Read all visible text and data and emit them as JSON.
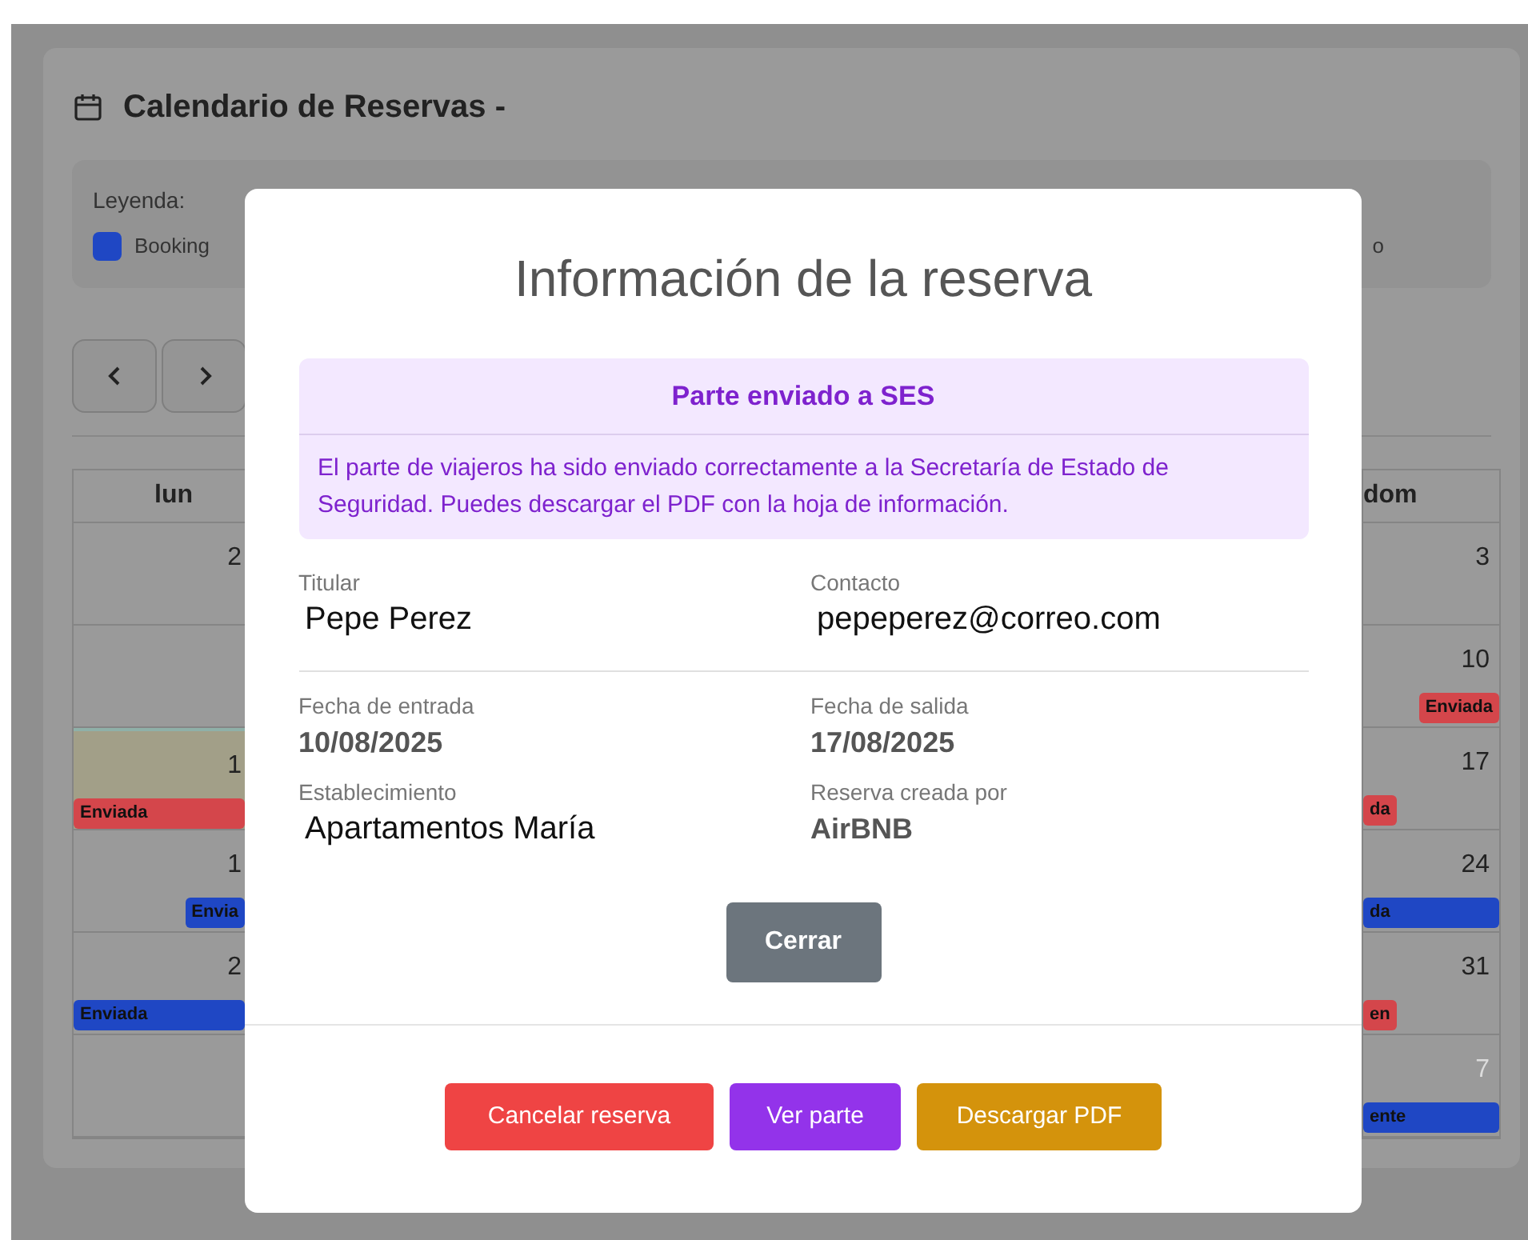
{
  "calendar_page": {
    "title": "Calendario de Reservas -",
    "legend": {
      "label": "Leyenda:",
      "items": [
        {
          "label": "Booking",
          "color": "#1f47c4"
        },
        {
          "label": "o"
        }
      ]
    },
    "columns": [
      "lun",
      "dom"
    ],
    "weeks": [
      {
        "lun": {
          "day": "2",
          "highlighted": false
        },
        "dom": {
          "day": "3",
          "muted": false
        }
      },
      {
        "lun": {
          "highlighted": false
        },
        "dom": {
          "day": "10",
          "muted": false,
          "badge": {
            "label": "Enviada",
            "kind": "tag_end",
            "color": "#d4464b"
          }
        }
      },
      {
        "lun": {
          "day": "1",
          "highlighted": true,
          "badge": {
            "label": "Enviada",
            "kind": "bar",
            "color": "#d4464b"
          }
        },
        "dom": {
          "day": "17",
          "muted": false,
          "badge": {
            "label": "da",
            "kind": "tag_start",
            "color": "#d4464b"
          }
        }
      },
      {
        "lun": {
          "day": "1",
          "highlighted": false,
          "badge": {
            "label": "Envia",
            "kind": "tag_end",
            "color": "#1f47c4"
          }
        },
        "dom": {
          "day": "24",
          "muted": false,
          "badge": {
            "label": "da",
            "kind": "bar",
            "color": "#1f47c4"
          }
        }
      },
      {
        "lun": {
          "day": "2",
          "highlighted": false,
          "badge": {
            "label": "Enviada",
            "kind": "bar",
            "color": "#1f47c4"
          }
        },
        "dom": {
          "day": "31",
          "muted": false,
          "badge": {
            "label": "en",
            "kind": "tag_start",
            "color": "#d4464b"
          }
        }
      },
      {
        "lun": {
          "highlighted": false
        },
        "dom": {
          "day": "7",
          "muted": true,
          "badge": {
            "label": "ente",
            "kind": "bar",
            "color": "#1f47c4"
          }
        }
      }
    ]
  },
  "modal": {
    "title": "Información de la reserva",
    "alert": {
      "heading": "Parte enviado a SES",
      "message": "El parte de viajeros ha sido enviado correctamente a la Secretaría de Estado de Seguridad. Puedes descargar el PDF con la hoja de información."
    },
    "fields": [
      {
        "label": "Titular",
        "value": "Pepe Perez",
        "kind": "plain"
      },
      {
        "label": "Contacto",
        "value": "pepeperez@correo.com",
        "kind": "plain"
      },
      {
        "kind": "divider"
      },
      {
        "label": "Fecha de entrada",
        "value": "10/08/2025",
        "kind": "strong"
      },
      {
        "label": "Fecha de salida",
        "value": "17/08/2025",
        "kind": "strong"
      },
      {
        "label": "Establecimiento",
        "value": "Apartamentos María",
        "kind": "plain"
      },
      {
        "label": "Reserva creada por",
        "value": "AirBNB",
        "kind": "strong"
      }
    ],
    "close_button": "Cerrar",
    "footer_buttons": [
      {
        "label": "Cancelar reserva",
        "kind": "danger"
      },
      {
        "label": "Ver parte",
        "kind": "purple"
      },
      {
        "label": "Descargar PDF",
        "kind": "warning"
      }
    ]
  }
}
